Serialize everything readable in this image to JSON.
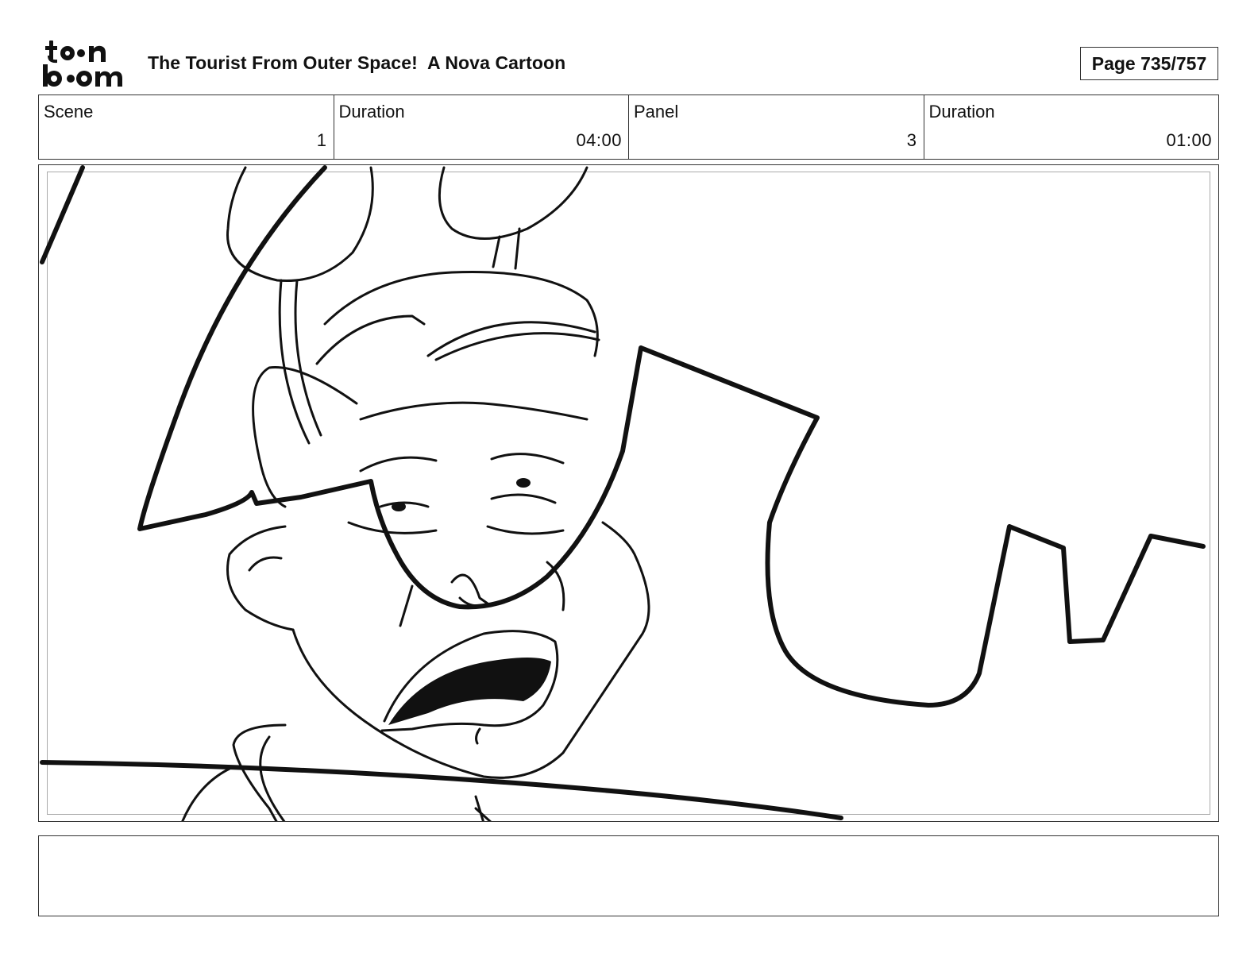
{
  "header": {
    "logo_text": "toon boom",
    "title": "The Tourist From Outer Space!  A Nova Cartoon",
    "page_label": "Page 735/757"
  },
  "info": {
    "scene_label": "Scene",
    "scene_value": "1",
    "scene_duration_label": "Duration",
    "scene_duration_value": "04:00",
    "panel_label": "Panel",
    "panel_value": "3",
    "panel_duration_label": "Duration",
    "panel_duration_value": "01:00"
  },
  "panel": {
    "image": "storyboard-sketch"
  },
  "notes": {
    "text": ""
  }
}
